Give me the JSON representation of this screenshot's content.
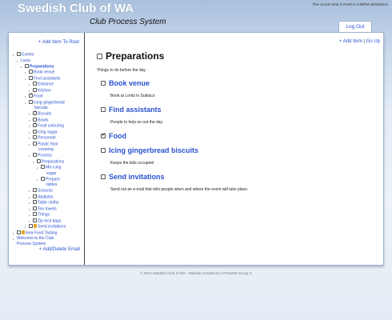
{
  "header": {
    "site_title": "Swedish Club of WA",
    "subtitle": "Club Process System",
    "clock": "The current time in Perth is 2:59PM 28/06/2014",
    "logout_label": "Log Out"
  },
  "sidebar": {
    "add_root_label": "+ Add Item To Root",
    "tree": [
      {
        "label": "Events",
        "level": 0,
        "bullet": true,
        "checkbox": true,
        "checked": false
      },
      {
        "label": "Lucia",
        "level": 1,
        "bullet": true,
        "checkbox": false,
        "checked": false
      },
      {
        "label": "Preparations",
        "level": 2,
        "bullet": true,
        "checkbox": true,
        "checked": false,
        "bold": true
      },
      {
        "label": "Book venue",
        "level": 3,
        "bullet": true,
        "checkbox": true,
        "checked": false
      },
      {
        "label": "Find assistants",
        "level": 3,
        "bullet": true,
        "checkbox": true,
        "checked": false
      },
      {
        "label": "Entrance",
        "level": 4,
        "bullet": true,
        "checkbox": true,
        "checked": false
      },
      {
        "label": "Kitchen",
        "level": 4,
        "bullet": true,
        "checkbox": true,
        "checked": false
      },
      {
        "label": "Food",
        "level": 3,
        "bullet": true,
        "checkbox": true,
        "checked": true
      },
      {
        "label": "Icing gingerbread",
        "level": 3,
        "bullet": true,
        "checkbox": true,
        "checked": false
      },
      {
        "label": "biscuits",
        "level": 3,
        "bullet": false,
        "checkbox": false,
        "checked": false,
        "continuation": true
      },
      {
        "label": "Biscuits",
        "level": 4,
        "bullet": true,
        "checkbox": true,
        "checked": true
      },
      {
        "label": "Bowls",
        "level": 4,
        "bullet": true,
        "checkbox": true,
        "checked": false
      },
      {
        "label": "Food colouring",
        "level": 4,
        "bullet": true,
        "checkbox": true,
        "checked": true
      },
      {
        "label": "Icing sugar",
        "level": 4,
        "bullet": true,
        "checkbox": true,
        "checked": false
      },
      {
        "label": "Personnel",
        "level": 4,
        "bullet": true,
        "checkbox": true,
        "checked": false
      },
      {
        "label": "Plastic floor",
        "level": 4,
        "bullet": true,
        "checkbox": true,
        "checked": false
      },
      {
        "label": "covering",
        "level": 4,
        "bullet": false,
        "checkbox": false,
        "checked": false,
        "continuation": true
      },
      {
        "label": "Process",
        "level": 4,
        "bullet": true,
        "checkbox": true,
        "checked": false
      },
      {
        "label": "Preparations",
        "level": 5,
        "bullet": true,
        "checkbox": true,
        "checked": false
      },
      {
        "label": "Mix icing",
        "level": 6,
        "bullet": true,
        "checkbox": true,
        "checked": false
      },
      {
        "label": "sugar",
        "level": 6,
        "bullet": false,
        "checkbox": false,
        "checked": false,
        "continuation": true
      },
      {
        "label": "Prepare",
        "level": 6,
        "bullet": true,
        "checkbox": true,
        "checked": false
      },
      {
        "label": "tables",
        "level": 6,
        "bullet": false,
        "checkbox": false,
        "checked": false,
        "continuation": true
      },
      {
        "label": "Scissors",
        "level": 4,
        "bullet": true,
        "checkbox": true,
        "checked": false
      },
      {
        "label": "Spatulas",
        "level": 4,
        "bullet": true,
        "checkbox": true,
        "checked": false
      },
      {
        "label": "Table cloths",
        "level": 4,
        "bullet": true,
        "checkbox": true,
        "checked": false
      },
      {
        "label": "Tea towels",
        "level": 4,
        "bullet": true,
        "checkbox": true,
        "checked": false
      },
      {
        "label": "Things",
        "level": 4,
        "bullet": true,
        "checkbox": true,
        "checked": false
      },
      {
        "label": "Zip lock bags",
        "level": 4,
        "bullet": true,
        "checkbox": true,
        "checked": false
      },
      {
        "label": "Send invitations",
        "level": 3,
        "bullet": true,
        "checkbox": true,
        "checked": false,
        "lock": true
      },
      {
        "label": "Ikea Food Tasting",
        "level": 0,
        "bullet": true,
        "checkbox": true,
        "checked": false,
        "lock": true
      },
      {
        "label": "Welcome to the Club",
        "level": 0,
        "bullet": true,
        "checkbox": false,
        "checked": false
      },
      {
        "label": "Process System",
        "level": 0,
        "bullet": false,
        "checkbox": false,
        "checked": false,
        "continuation": true
      }
    ],
    "add_email_label": "+ Add/Delete Email"
  },
  "main": {
    "add_item_label": "+ Add Item",
    "separator": "|",
    "go_up_label": "Go Up",
    "title": "Preparations",
    "description": "Things to do before the day.",
    "tasks": [
      {
        "title": "Book venue",
        "checked": false,
        "description": "Book at Lords in Subiaco"
      },
      {
        "title": "Find assistants",
        "checked": false,
        "description": "People to help on out the day."
      },
      {
        "title": "Food",
        "checked": true,
        "description": ""
      },
      {
        "title": "Icing gingerbread biscuits",
        "checked": false,
        "description": "Keeps the kids occupied"
      },
      {
        "title": "Send invitations",
        "checked": false,
        "description": "Send out an e-mail that tells people when and where the event will take place."
      }
    ]
  },
  "footer": {
    "text": "© 2013 Swedish Club of WA - Website Created by CITS3200 Group G"
  },
  "colors": {
    "link": "#2b52d0",
    "lock": "#e6a41e"
  }
}
